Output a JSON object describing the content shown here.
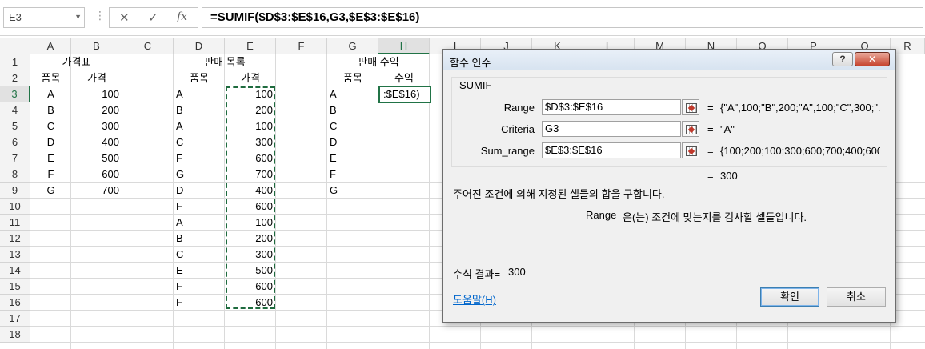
{
  "formula_bar": {
    "name_box": "E3",
    "cancel_icon": "✕",
    "enter_icon": "✓",
    "fx_label": "fx",
    "formula": "=SUMIF($D$3:$E$16,G3,$E$3:$E$16)"
  },
  "columns": [
    "A",
    "B",
    "C",
    "D",
    "E",
    "F",
    "G",
    "H",
    "I",
    "J",
    "K",
    "L",
    "M",
    "N",
    "O",
    "P",
    "Q",
    "R"
  ],
  "rows": [
    "1",
    "2",
    "3",
    "4",
    "5",
    "6",
    "7",
    "8",
    "9",
    "10",
    "11",
    "12",
    "13",
    "14",
    "15",
    "16",
    "17",
    "18"
  ],
  "sheet": {
    "title_price": "가격표",
    "title_sales": "판매 목록",
    "title_revenue": "판매 수익",
    "hdr_item_a": "품목",
    "hdr_price_b": "가격",
    "hdr_item_d": "품목",
    "hdr_price_e": "가격",
    "hdr_item_g": "품목",
    "hdr_revenue_h": "수익",
    "price_items": [
      "A",
      "B",
      "C",
      "D",
      "E",
      "F",
      "G"
    ],
    "price_values": [
      "100",
      "200",
      "300",
      "400",
      "500",
      "600",
      "700"
    ],
    "sales_items": [
      "A",
      "B",
      "A",
      "C",
      "F",
      "G",
      "D",
      "F",
      "A",
      "B",
      "C",
      "E",
      "F",
      "F"
    ],
    "sales_values": [
      "100",
      "200",
      "100",
      "300",
      "600",
      "700",
      "400",
      "600",
      "100",
      "200",
      "300",
      "500",
      "600",
      "600"
    ],
    "revenue_items": [
      "A",
      "B",
      "C",
      "D",
      "E",
      "F",
      "G"
    ],
    "active_cell_text": ":$E$16)"
  },
  "dialog": {
    "title": "함수 인수",
    "help_label": "?",
    "close_label": "✕",
    "function_name": "SUMIF",
    "args": [
      {
        "label": "Range",
        "value": "$D$3:$E$16",
        "result": "{\"A\",100;\"B\",200;\"A\",100;\"C\",300;\"..."
      },
      {
        "label": "Criteria",
        "value": "G3",
        "result": "\"A\""
      },
      {
        "label": "Sum_range",
        "value": "$E$3:$E$16",
        "result": "{100;200;100;300;600;700;400;600;"
      }
    ],
    "eq": "=",
    "function_result": "300",
    "description": "주어진 조건에 의해 지정된 셀들의 합을 구합니다.",
    "arg_name": "Range",
    "arg_description": "은(는) 조건에 맞는지를 검사할 셀들입니다.",
    "formula_result_label": "수식 결과=",
    "formula_result_value": "300",
    "help_link": "도움말(H)",
    "ok_label": "확인",
    "cancel_label": "취소"
  }
}
